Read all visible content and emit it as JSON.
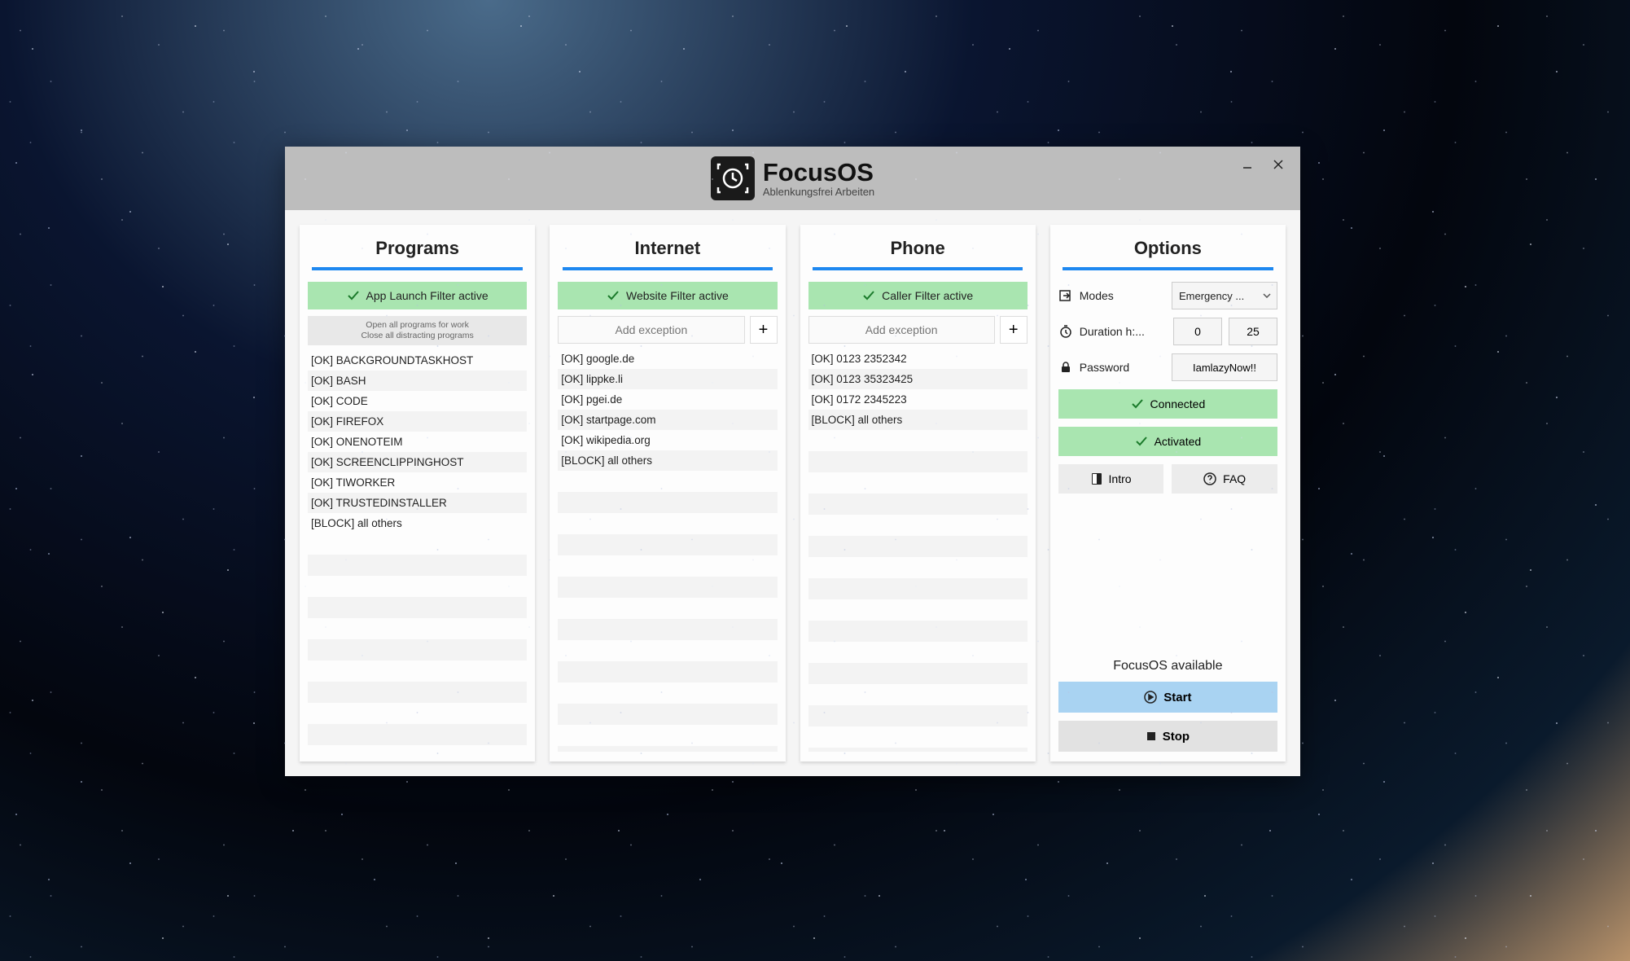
{
  "app": {
    "title": "FocusOS",
    "subtitle": "Ablenkungsfrei Arbeiten"
  },
  "panels": {
    "programs": {
      "title": "Programs",
      "filter_status": "App Launch Filter active",
      "hint_line1": "Open all programs for work",
      "hint_line2": "Close all distracting programs",
      "items": [
        "[OK] BACKGROUNDTASKHOST",
        "[OK] BASH",
        "[OK] CODE",
        "[OK] FIREFOX",
        "[OK] ONENOTEIM",
        "[OK] SCREENCLIPPINGHOST",
        "[OK] TIWORKER",
        "[OK] TRUSTEDINSTALLER",
        "[BLOCK] all others"
      ]
    },
    "internet": {
      "title": "Internet",
      "filter_status": "Website Filter active",
      "add_placeholder": "Add exception",
      "items": [
        "[OK] google.de",
        "[OK] lippke.li",
        "[OK] pgei.de",
        "[OK] startpage.com",
        "[OK] wikipedia.org",
        "[BLOCK] all others"
      ]
    },
    "phone": {
      "title": "Phone",
      "filter_status": "Caller Filter active",
      "add_placeholder": "Add exception",
      "items": [
        "[OK] 0123 2352342",
        "[OK] 0123 35323425",
        "[OK] 0172 2345223",
        "[BLOCK] all others"
      ]
    },
    "options": {
      "title": "Options",
      "modes_label": "Modes",
      "modes_value": "Emergency ...",
      "duration_label": "Duration h:...",
      "duration_h": "0",
      "duration_m": "25",
      "password_label": "Password",
      "password_value": "IamlazyNow!!",
      "connected_label": "Connected",
      "activated_label": "Activated",
      "intro_label": "Intro",
      "faq_label": "FAQ",
      "available_label": "FocusOS available",
      "start_label": "Start",
      "stop_label": "Stop"
    }
  }
}
